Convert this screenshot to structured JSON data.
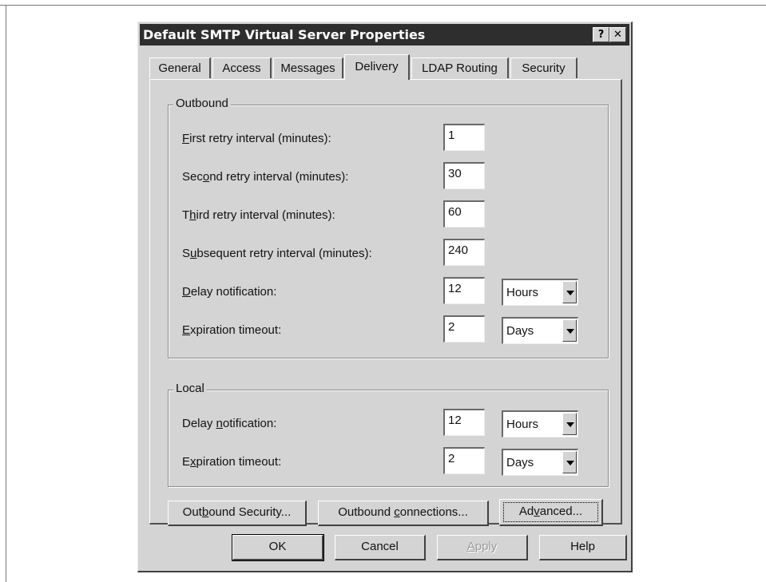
{
  "dialog": {
    "title": "Default SMTP Virtual Server Properties",
    "help_button": "?",
    "close_button": "✕"
  },
  "tabs": [
    "General",
    "Access",
    "Messages",
    "Delivery",
    "LDAP Routing",
    "Security"
  ],
  "active_tab": "Delivery",
  "outbound": {
    "legend": "Outbound",
    "first_retry": {
      "label_pre": "",
      "label_key": "F",
      "label_post": "irst retry interval (minutes):",
      "value": "1"
    },
    "second_retry": {
      "label_pre": "Sec",
      "label_key": "o",
      "label_post": "nd retry interval (minutes):",
      "value": "30"
    },
    "third_retry": {
      "label_pre": "T",
      "label_key": "h",
      "label_post": "ird retry interval (minutes):",
      "value": "60"
    },
    "subsequent_retry": {
      "label_pre": "S",
      "label_key": "u",
      "label_post": "bsequent retry interval (minutes):",
      "value": "240"
    },
    "delay_notification": {
      "label_pre": "",
      "label_key": "D",
      "label_post": "elay notification:",
      "value": "12",
      "unit": "Hours"
    },
    "expiration_timeout": {
      "label_pre": "",
      "label_key": "E",
      "label_post": "xpiration timeout:",
      "value": "2",
      "unit": "Days"
    }
  },
  "local": {
    "legend": "Local",
    "delay_notification": {
      "label_pre": "Delay ",
      "label_key": "n",
      "label_post": "otification:",
      "value": "12",
      "unit": "Hours"
    },
    "expiration_timeout": {
      "label_pre": "E",
      "label_key": "x",
      "label_post": "piration timeout:",
      "value": "2",
      "unit": "Days"
    }
  },
  "buttons": {
    "outbound_security": {
      "pre": "Out",
      "key": "b",
      "post": "ound Security..."
    },
    "outbound_connections": {
      "pre": "Outbound ",
      "key": "c",
      "post": "onnections..."
    },
    "advanced": {
      "pre": "Ad",
      "key": "v",
      "post": "anced..."
    },
    "ok": "OK",
    "cancel": "Cancel",
    "apply": {
      "pre": "",
      "key": "A",
      "post": "pply"
    },
    "help": "Help"
  }
}
